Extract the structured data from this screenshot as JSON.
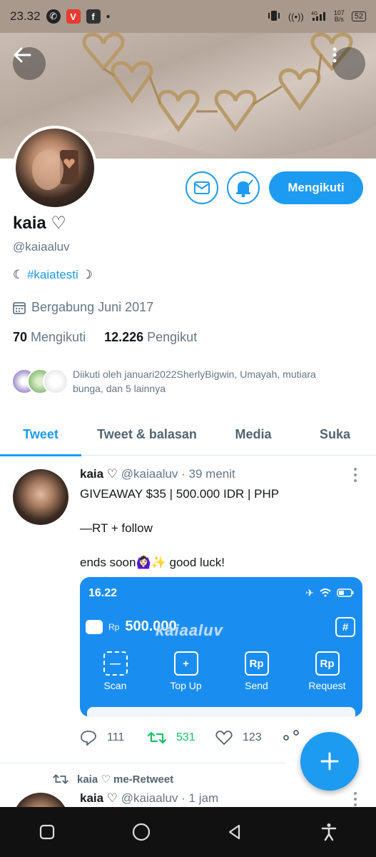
{
  "status_bar": {
    "time": "23.32",
    "network": "4G",
    "speed_value": "107",
    "speed_unit": "B/s",
    "battery": "52"
  },
  "profile": {
    "name": "kaia ♡",
    "handle": "@kaiaaluv",
    "bio_prefix": "☾ ",
    "bio_hashtag": "#kaiatesti",
    "bio_suffix": " ☽",
    "joined": "Bergabung Juni 2017",
    "following_count": "70",
    "following_label": "Mengikuti",
    "followers_count": "12.226",
    "followers_label": "Pengikut",
    "followed_by": "Diikuti oleh januari2022SherlyBigwin, Umayah, mutiara bunga, dan 5 lainnya",
    "follow_button": "Mengikuti"
  },
  "tabs": [
    {
      "label": "Tweet",
      "active": true
    },
    {
      "label": "Tweet & balasan",
      "active": false
    },
    {
      "label": "Media",
      "active": false
    },
    {
      "label": "Suka",
      "active": false
    }
  ],
  "tweet": {
    "name": "kaia ♡",
    "handle_time": "@kaiaaluv · 39 menit",
    "line1": "GIVEAWAY $35 | 500.000 IDR | PHP",
    "line2": "—RT + follow",
    "line3": "ends soon🙆🏻‍♀️✨ good luck!",
    "media": {
      "time": "16.22",
      "currency": "Rp",
      "amount": "500.000",
      "watermark": "kaiaaluv",
      "actions": [
        "Scan",
        "Top Up",
        "Send",
        "Request"
      ]
    },
    "replies": "111",
    "retweets": "531",
    "likes": "123"
  },
  "retweet_note": "kaia ♡ me-Retweet",
  "tweet2": {
    "name": "kaia ♡",
    "handle_time": "@kaiaaluv · 1 jam"
  },
  "colors": {
    "accent": "#1d9bf0",
    "retweet": "#17bf63",
    "muted": "#657786"
  }
}
